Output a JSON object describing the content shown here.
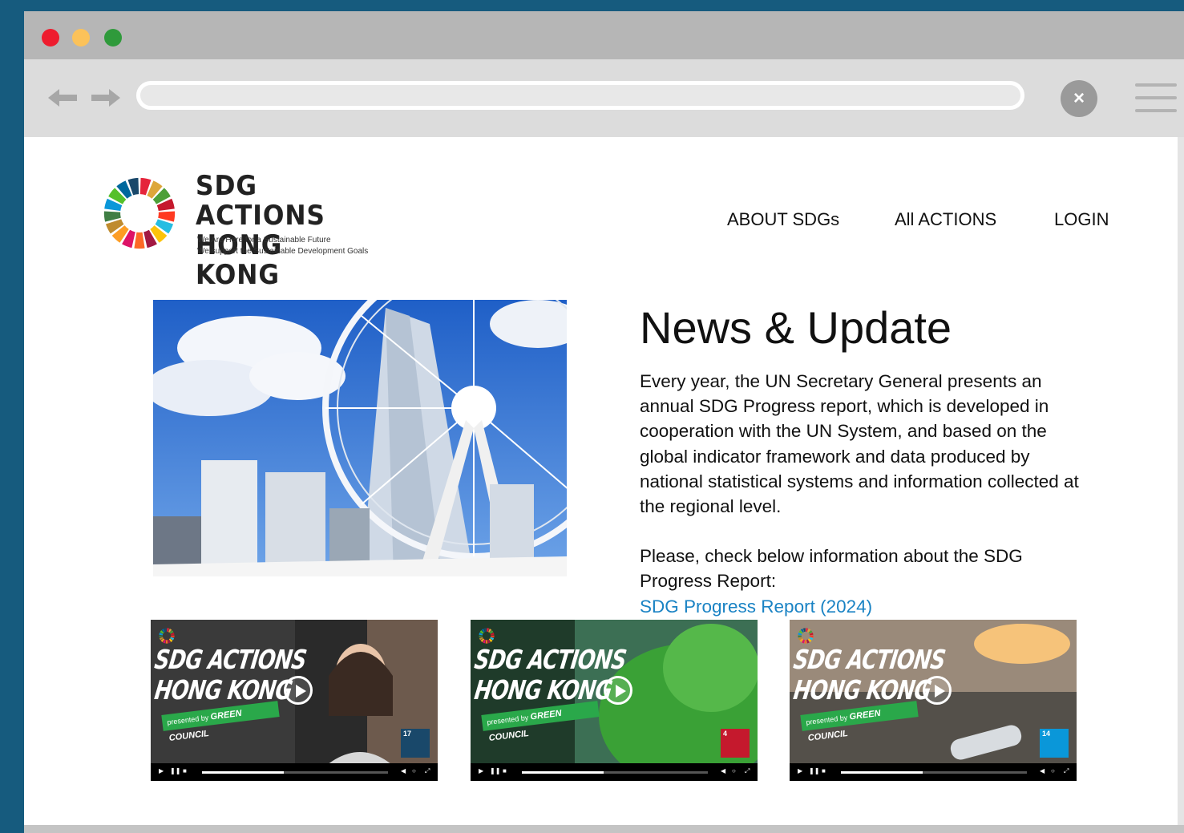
{
  "brand": {
    "title_line1": "SDG ACTIONS",
    "title_line2": "HONG KONG",
    "tagline1": "We Are Here for a Sustainable Future",
    "tagline2": "We support the Sustainable Development Goals"
  },
  "nav": {
    "items": [
      {
        "label": "ABOUT SDGs"
      },
      {
        "label": "All ACTIONS"
      },
      {
        "label": "LOGIN"
      }
    ]
  },
  "news": {
    "title": "News & Update",
    "paragraph1": "Every year, the UN Secretary General presents an annual SDG Progress report, which is developed in cooperation with the UN System, and based on the global indicator framework and data produced by national statistical systems and information collected at the regional level.",
    "paragraph2": "Please, check below information about the SDG Progress Report:",
    "link": "SDG Progress Report (2024)"
  },
  "videos": [
    {
      "title_line1": "SDG ACTIONS",
      "title_line2": "HONG KONG",
      "presented_by": "presented by",
      "sponsor": "GREEN COUNCIL",
      "goal_number": "17",
      "goal_color": "#19486a",
      "progress": 0.44
    },
    {
      "title_line1": "SDG ACTIONS",
      "title_line2": "HONG KONG",
      "presented_by": "presented by",
      "sponsor": "GREEN COUNCIL",
      "goal_number": "4",
      "goal_color": "#c5192d",
      "progress": 0.44
    },
    {
      "title_line1": "SDG ACTIONS",
      "title_line2": "HONG KONG",
      "presented_by": "presented by",
      "sponsor": "GREEN COUNCIL",
      "goal_number": "14",
      "goal_color": "#0a97d9",
      "progress": 0.44
    }
  ],
  "colors": {
    "link": "#1a83c4",
    "frame": "#165b7e",
    "banner_green": "#2aa84a"
  },
  "icons": [
    "back-arrow-icon",
    "forward-arrow-icon",
    "close-icon",
    "menu-icon",
    "sdg-wheel-icon",
    "play-icon"
  ]
}
